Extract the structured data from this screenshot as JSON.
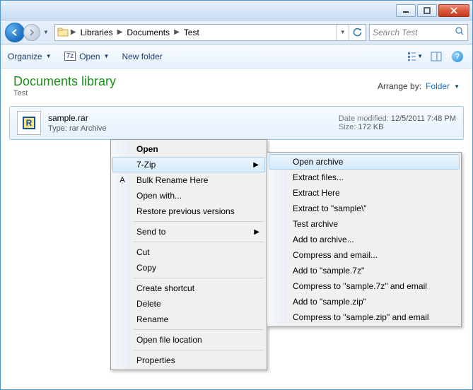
{
  "breadcrumb": {
    "seg1": "Libraries",
    "seg2": "Documents",
    "seg3": "Test"
  },
  "search": {
    "placeholder": "Search Test"
  },
  "toolbar": {
    "organize": "Organize",
    "open": "Open",
    "newfolder": "New folder"
  },
  "header": {
    "title": "Documents library",
    "subtitle": "Test",
    "arrange_label": "Arrange by:",
    "arrange_value": "Folder"
  },
  "file": {
    "name": "sample.rar",
    "type_label": "Type:",
    "type_value": "rar Archive",
    "modified_label": "Date modified:",
    "modified_value": "12/5/2011 7:48 PM",
    "size_label": "Size:",
    "size_value": "172 KB"
  },
  "menu1": {
    "open": "Open",
    "sevenzip": "7-Zip",
    "bulkrename": "Bulk Rename Here",
    "openwith": "Open with...",
    "restore": "Restore previous versions",
    "sendto": "Send to",
    "cut": "Cut",
    "copy": "Copy",
    "shortcut": "Create shortcut",
    "delete": "Delete",
    "rename": "Rename",
    "openloc": "Open file location",
    "properties": "Properties"
  },
  "menu2": {
    "openarchive": "Open archive",
    "extractfiles": "Extract files...",
    "extracthere": "Extract Here",
    "extractto": "Extract to \"sample\\\"",
    "testarchive": "Test archive",
    "addarchive": "Add to archive...",
    "compressemail": "Compress and email...",
    "addsample7z": "Add to \"sample.7z\"",
    "compress7zemail": "Compress to \"sample.7z\" and email",
    "addsamplezip": "Add to \"sample.zip\"",
    "compresszipemail": "Compress to \"sample.zip\" and email"
  }
}
